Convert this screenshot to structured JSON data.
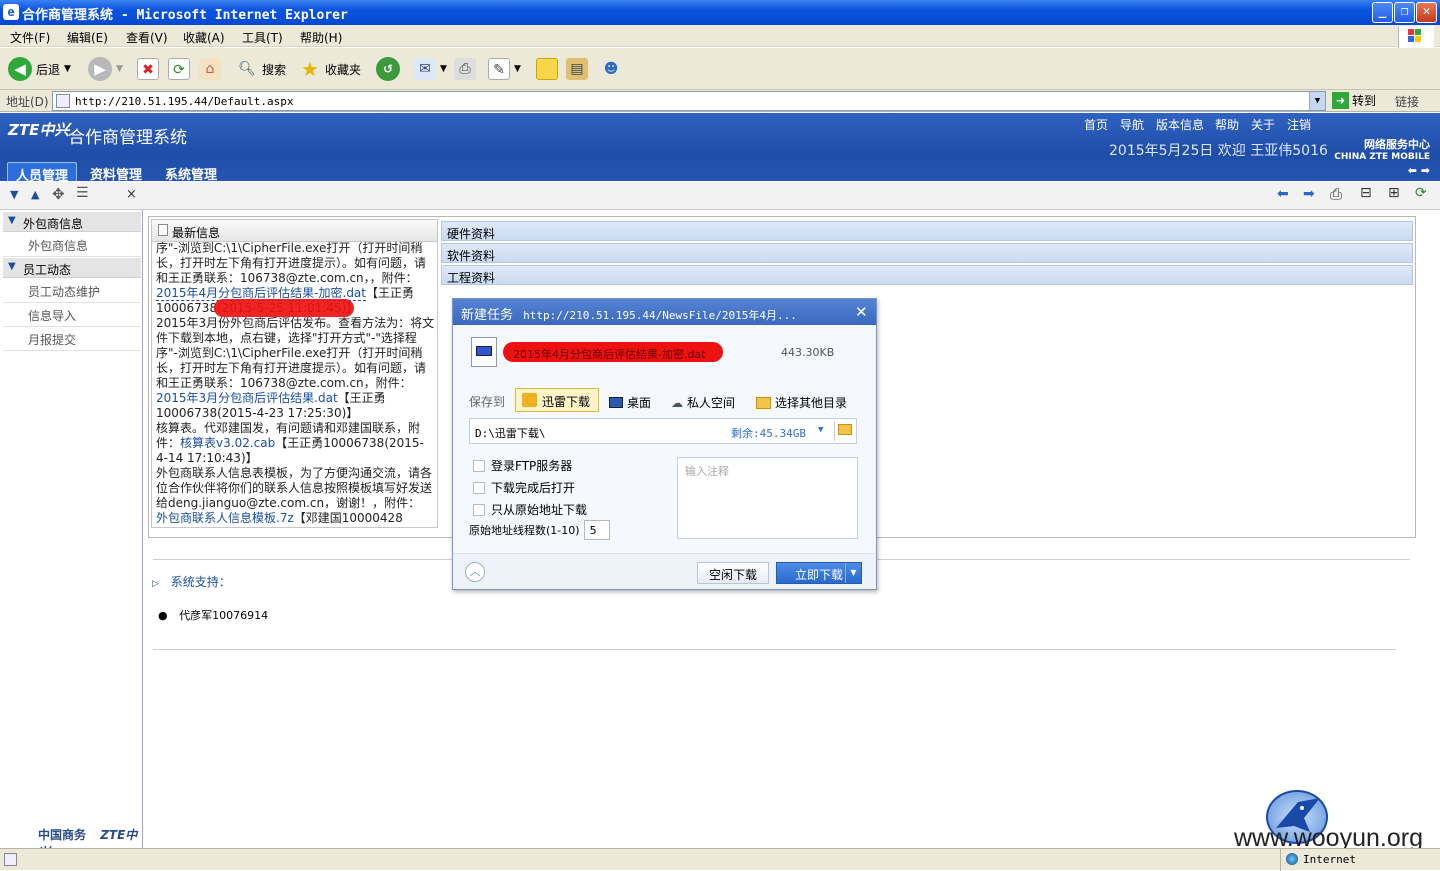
{
  "window": {
    "title": "合作商管理系统 - Microsoft Internet Explorer",
    "ie_icon": "ie-icon"
  },
  "menu": [
    "文件(F)",
    "编辑(E)",
    "查看(V)",
    "收藏(A)",
    "工具(T)",
    "帮助(H)"
  ],
  "toolbar": {
    "back": "后退",
    "search": "搜索",
    "favorites": "收藏夹"
  },
  "address": {
    "label": "地址(D)",
    "url": "http://210.51.195.44/Default.aspx",
    "go": "转到",
    "links": "链接"
  },
  "app": {
    "logo": "ZTE中兴",
    "title": "合作商管理系统",
    "links": [
      "首页",
      "导航",
      "版本信息",
      "帮助",
      "关于",
      "注销"
    ],
    "welcome": "2015年5月25日 欢迎 王亚伟5016",
    "service": "网络服务中心",
    "service_en": "CHINA ZTE MOBILE",
    "tabs": [
      "人员管理",
      "资料管理",
      "系统管理"
    ]
  },
  "sidebar": {
    "groups": [
      {
        "title": "外包商信息",
        "items": [
          "外包商信息"
        ]
      },
      {
        "title": "员工动态",
        "items": [
          "员工动态维护",
          "信息导入",
          "月报提交"
        ]
      }
    ],
    "footer": "中国商务",
    "footer_logo": "ZTE中兴"
  },
  "news": {
    "title": "最新信息",
    "lines": [
      "序\"-浏览到C:\\1\\CipherFile.exe打开（打开时间稍",
      "长，打开时左下角有打开进度提示）。如有问题，请",
      "和王正勇联系：106738@zte.com.cn，，附件："
    ],
    "link1": "2015年4月分包商后评估结果-加密.dat",
    "link1_after": "【王正勇",
    "line_l1b": "10006738(2015-5-25 11:01:45)】",
    "lines2": [
      "2015年3月份外包商后评估发布。查看方法为：将文",
      "件下载到本地，点右键，选择\"打开方式\"-\"选择程",
      "序\"-浏览到C:\\1\\CipherFile.exe打开（打开时间稍",
      "长，打开时左下角有打开进度提示）。如有问题，请",
      "和王正勇联系：106738@zte.com.cn，附件："
    ],
    "link2": "2015年3月分包商后评估结果.dat",
    "link2_after": "【王正勇",
    "line_l2b": "10006738(2015-4-23 17:25:30)】",
    "line3a": "核算表。代邓建国发，有问题请和邓建国联系，附",
    "line3b_pre": "件：",
    "link3": "核算表v3.02.cab",
    "link3_after": "【王正勇10006738(2015-",
    "line3c": "4-14 17:10:43)】",
    "lines4": [
      "外包商联系人信息表模板，为了方便沟通交流，请各",
      "位合作伙伴将你们的联系人信息按照模板填写好发送",
      "给deng.jianguo@zte.com.cn，谢谢！，附件："
    ],
    "link4": "外包商联系人信息模板.7z",
    "link4_after": "【邓建国10000428"
  },
  "sections": [
    "硬件资料",
    "软件资料",
    "工程资料"
  ],
  "support": {
    "title": "系统支持：",
    "person": "代彦军10076914"
  },
  "dialog": {
    "title": "新建任务",
    "url": "http://210.51.195.44/NewsFile/2015年4月...",
    "filename": "2015年4月分包商后评估结果-加密.dat",
    "size": "443.30KB",
    "save_to": "保存到",
    "options": [
      "迅雷下载",
      "桌面",
      "私人空间",
      "选择其他目录"
    ],
    "path": "D:\\迅雷下载\\",
    "free": "剩余:45.34GB",
    "checks": [
      "登录FTP服务器",
      "下载完成后打开",
      "只从原始地址下载"
    ],
    "note_placeholder": "输入注释",
    "threads_label": "原始地址线程数(1-10)",
    "threads": "5",
    "idle": "空闲下载",
    "download": "立即下载"
  },
  "status": {
    "zone": "Internet",
    "watermark": "www.wooyun.org"
  }
}
